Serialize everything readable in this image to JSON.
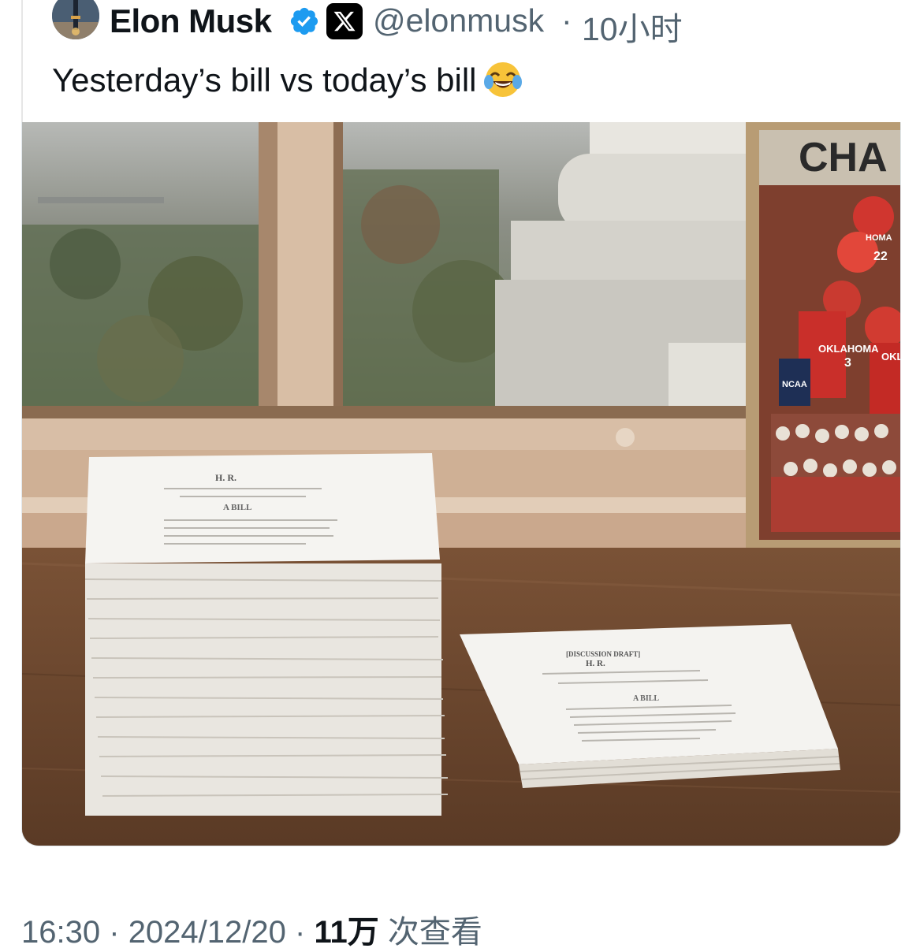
{
  "author": {
    "display_name": "Elon Musk",
    "handle": "@elonmusk",
    "separator": "·",
    "relative_time": "10小时",
    "avatar_icon": "avatar-photo",
    "verified_icon": "verified-badge-icon",
    "affiliate_icon": "x-logo-icon",
    "affiliate_glyph": "𝕏"
  },
  "tweet": {
    "text": "Yesterday’s bill vs today’s bill",
    "emoji": "face-with-tears-of-joy"
  },
  "media": {
    "type": "photo",
    "poster_text": {
      "title": "CHA",
      "line_1": "OKLAHOMA",
      "line_2": "OKL",
      "line_3": "HOMA",
      "badge": "NCAA",
      "number_a": "3",
      "number_b": "22"
    },
    "big_stack_text": {
      "heading": "H. R.",
      "subheading": "A BILL"
    },
    "small_stack_text": {
      "draft": "[DISCUSSION DRAFT]",
      "heading": "H. R.",
      "subheading": "A BILL"
    }
  },
  "footer": {
    "time": "16:30",
    "sep_1": "·",
    "date": "2024/12/20",
    "sep_2": "·",
    "views_count": "11万",
    "views_label": " 次查看"
  },
  "colors": {
    "text_primary": "#0f1419",
    "text_secondary": "#536471",
    "verified_blue": "#1d9bf0",
    "x_badge_bg": "#000000"
  }
}
